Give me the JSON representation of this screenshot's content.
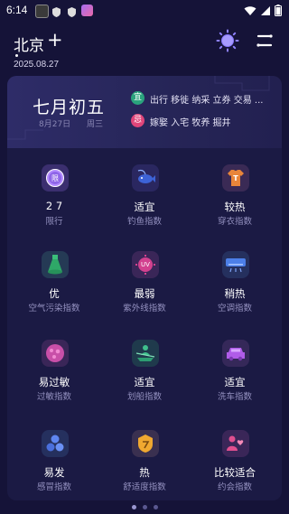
{
  "status_bar": {
    "time": "6:14",
    "icons": [
      "notification-app-icon",
      "shield-icon",
      "shield-icon",
      "gallery-icon"
    ],
    "system": [
      "wifi-icon",
      "signal-icon",
      "battery-icon"
    ]
  },
  "header": {
    "city": "北京",
    "add_symbol": "+",
    "date": "2025.08.27"
  },
  "almanac": {
    "lunar_date": "七月初五",
    "solar_date": "8月27日",
    "weekday": "周三",
    "yi_badge": "宜",
    "yi_text": "出行 移徙 纳采 立券 交易 ...",
    "ji_badge": "忌",
    "ji_text": "嫁娶 入宅 牧养 掘井"
  },
  "indices": [
    {
      "value": "2 7",
      "label": "限行",
      "icon": "license-restriction-icon"
    },
    {
      "value": "适宜",
      "label": "钓鱼指数",
      "icon": "fish-icon"
    },
    {
      "value": "较热",
      "label": "穿衣指数",
      "icon": "shirt-icon"
    },
    {
      "value": "优",
      "label": "空气污染指数",
      "icon": "air-bottle-icon"
    },
    {
      "value": "最弱",
      "label": "紫外线指数",
      "icon": "uv-icon"
    },
    {
      "value": "稍热",
      "label": "空调指数",
      "icon": "air-conditioner-icon"
    },
    {
      "value": "易过敏",
      "label": "过敏指数",
      "icon": "allergy-icon"
    },
    {
      "value": "适宜",
      "label": "划船指数",
      "icon": "boating-icon"
    },
    {
      "value": "适宜",
      "label": "洗车指数",
      "icon": "car-wash-icon"
    },
    {
      "value": "易发",
      "label": "感冒指数",
      "icon": "cold-pills-icon"
    },
    {
      "value": "热",
      "label": "舒适度指数",
      "icon": "comfort-icon"
    },
    {
      "value": "比较适合",
      "label": "约会指数",
      "icon": "dating-icon"
    }
  ],
  "uv_text": "UV",
  "shirt_text": "T",
  "restriction_text": "限",
  "pagination": {
    "count": 3,
    "active": 0
  },
  "colors": {
    "background": "#151338",
    "panel": "#1b1a44",
    "yi": "#2aa37d",
    "ji": "#e0457a"
  }
}
